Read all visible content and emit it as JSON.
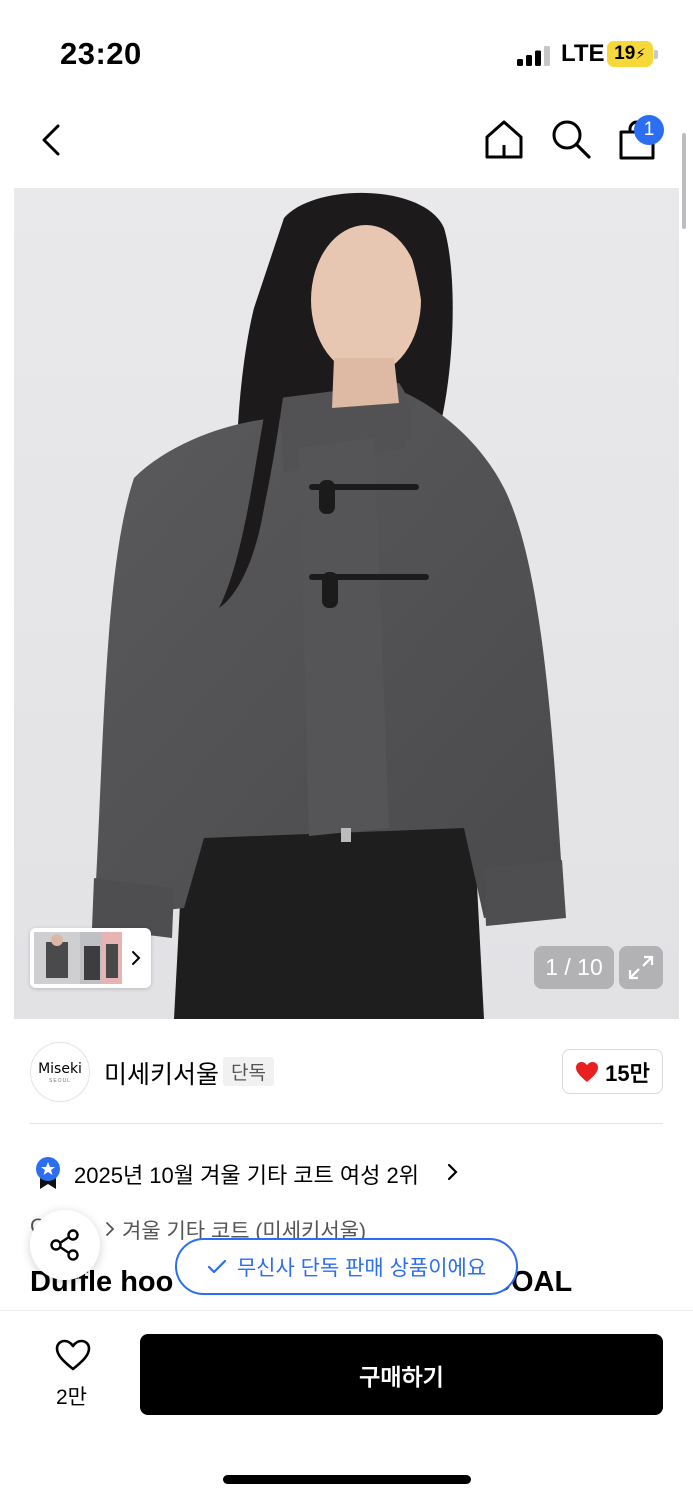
{
  "status_bar": {
    "time": "23:20",
    "network": "LTE",
    "battery": "19"
  },
  "nav": {
    "cart_count": "1"
  },
  "gallery": {
    "counter": "1 / 10"
  },
  "brand": {
    "logo_text": "Miseki",
    "logo_sub": "SEOUL",
    "name": "미세키서울",
    "exclusive_tag": "단독",
    "likes": "15만"
  },
  "ranking": {
    "text": "2025년 10월 겨울 기타 코트 여성 2위"
  },
  "category": {
    "prefix": "C",
    "path": "겨울 기타 코트 (미세키서울)"
  },
  "product": {
    "title_start": "Duffle hoo",
    "title_end": "COAL"
  },
  "toast": {
    "text": "무신사 단독 판매 상품이에요"
  },
  "bottom": {
    "wish_count": "2만",
    "buy_label": "구매하기"
  },
  "colors": {
    "accent": "#2b6ef2",
    "heart": "#e8201f",
    "battery": "#f6d838"
  }
}
